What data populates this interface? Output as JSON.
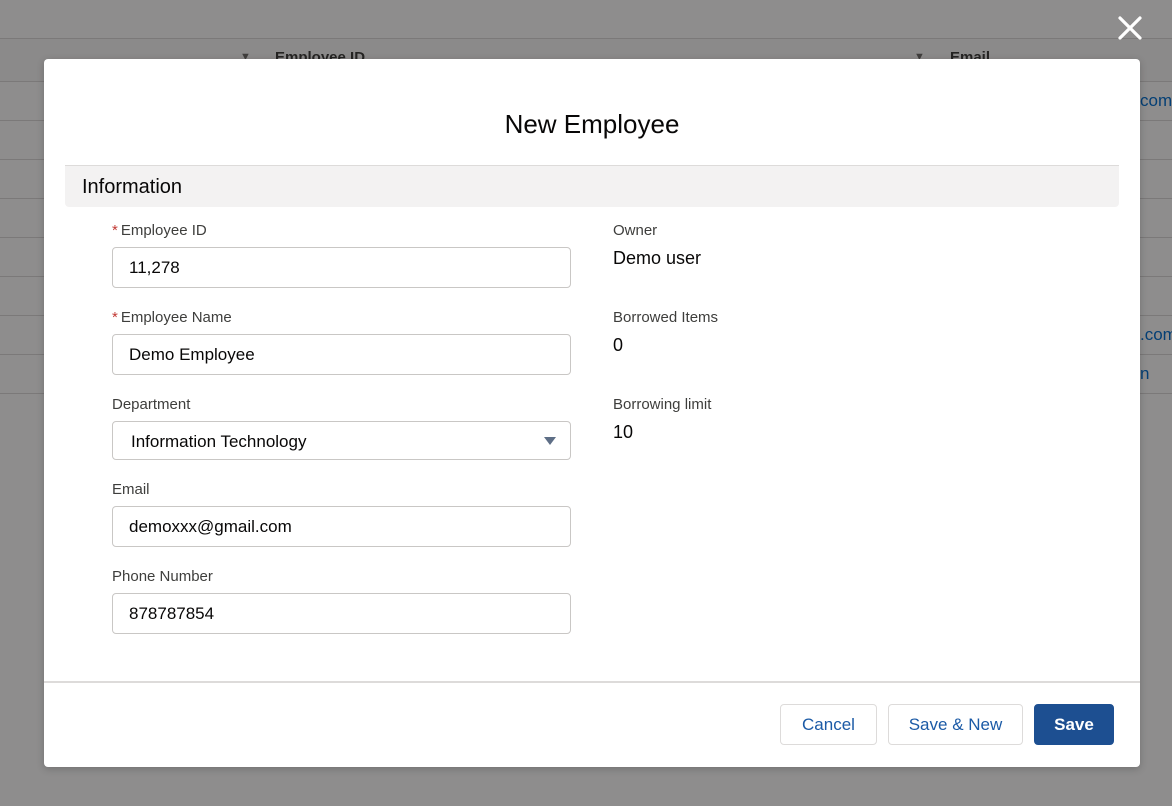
{
  "background": {
    "columns": [
      {
        "label": "Employee ID"
      },
      {
        "label": "Email"
      }
    ],
    "email_fragments": [
      "com",
      ".com",
      "n"
    ]
  },
  "modal": {
    "title": "New Employee",
    "section_title": "Information",
    "fields": {
      "employee_id": {
        "label": "Employee ID",
        "required_mark": "*",
        "value": "11,278"
      },
      "employee_name": {
        "label": "Employee Name",
        "required_mark": "*",
        "value": "Demo Employee"
      },
      "department": {
        "label": "Department",
        "value": "Information Technology"
      },
      "email": {
        "label": "Email",
        "value": "demoxxx@gmail.com"
      },
      "phone": {
        "label": "Phone Number",
        "value": "878787854"
      }
    },
    "readonly": {
      "owner": {
        "label": "Owner",
        "value": "Demo user"
      },
      "borrowed_items": {
        "label": "Borrowed Items",
        "value": "0"
      },
      "borrowing_limit": {
        "label": "Borrowing limit",
        "value": "10"
      }
    },
    "buttons": {
      "cancel": "Cancel",
      "save_new": "Save & New",
      "save": "Save"
    }
  },
  "colors": {
    "brand": "#1d4f91",
    "required": "#c23934",
    "link": "#0070d2"
  },
  "icons": {
    "close": "close-icon",
    "dropdown": "chevron-down-icon"
  }
}
